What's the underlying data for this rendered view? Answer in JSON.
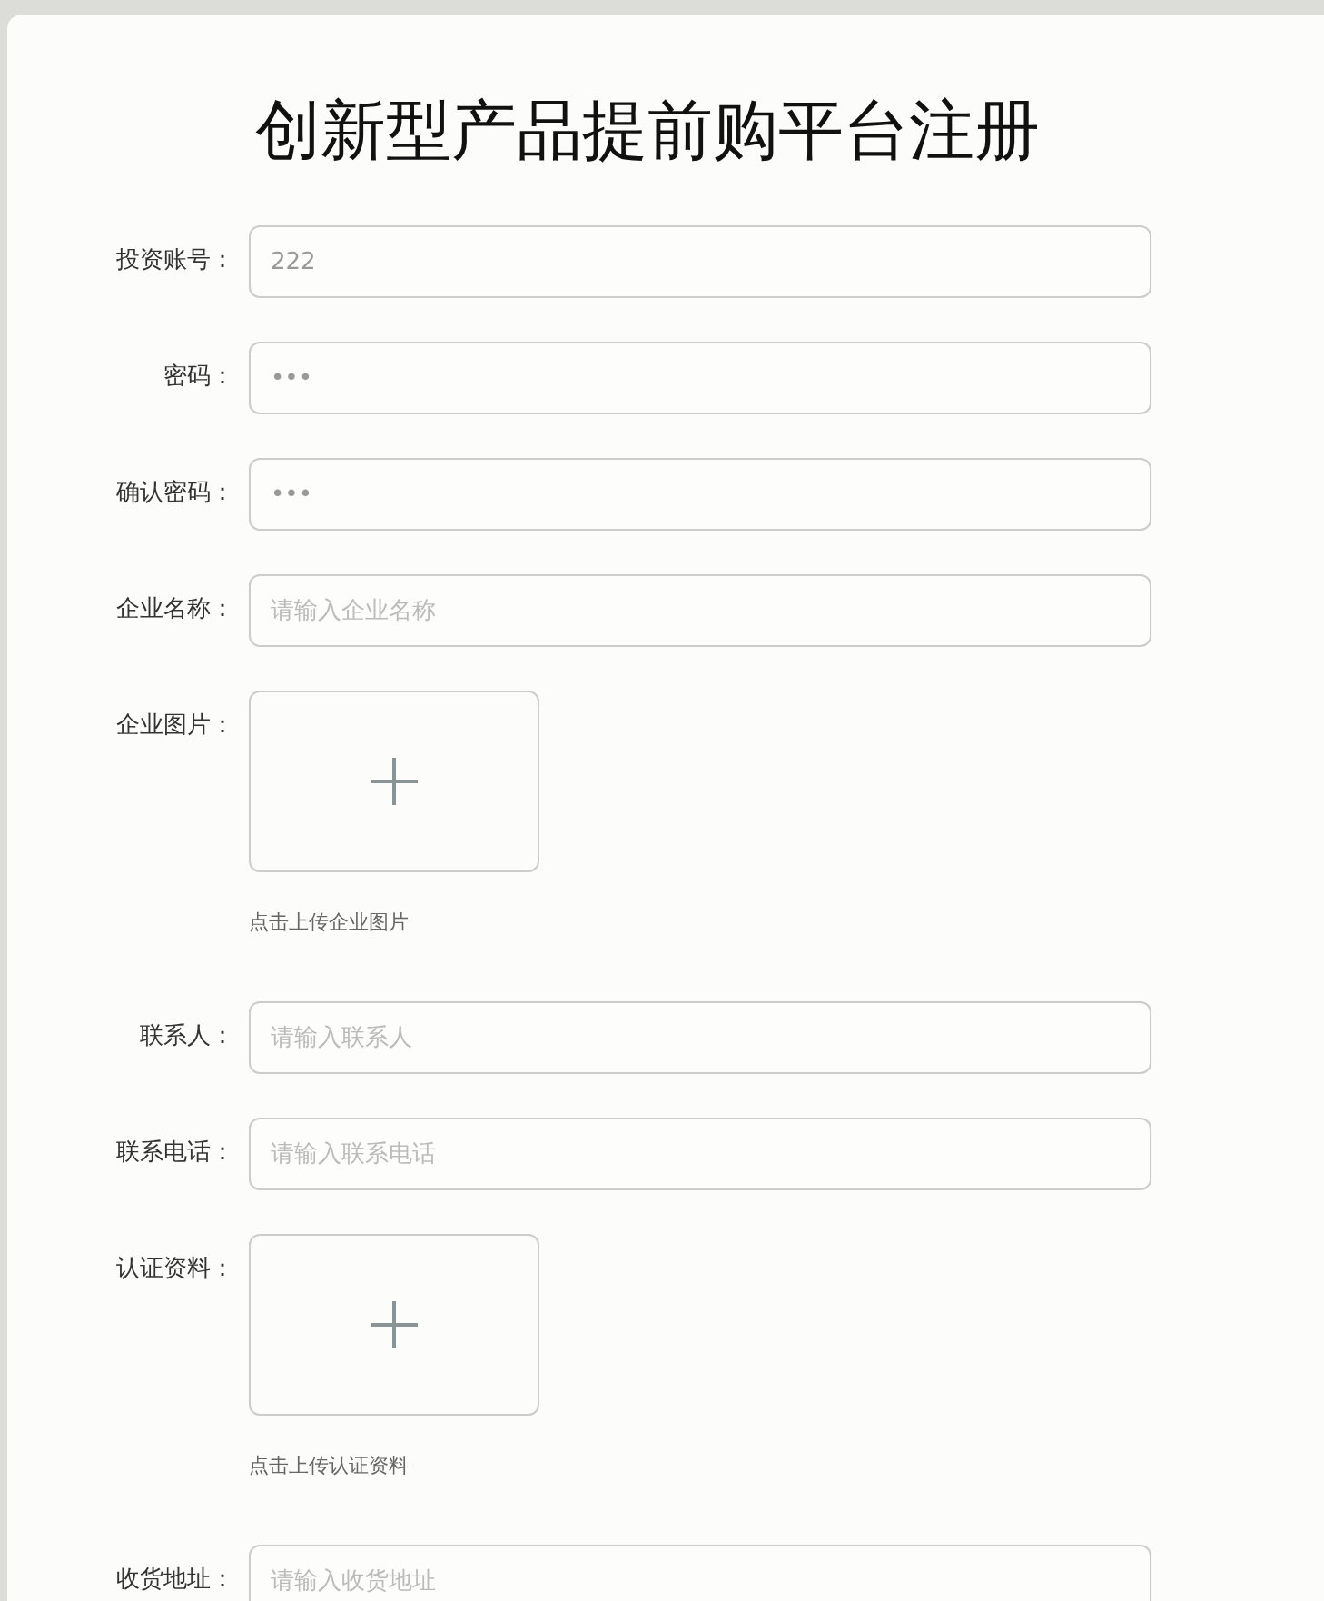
{
  "title": "创新型产品提前购平台注册",
  "fields": [
    {
      "kind": "text",
      "label": "投资账号：",
      "value": "222"
    },
    {
      "kind": "text",
      "label": "密码：",
      "value": "•••"
    },
    {
      "kind": "text",
      "label": "确认密码：",
      "value": "•••"
    },
    {
      "kind": "text",
      "label": "企业名称：",
      "placeholder": "请输入企业名称"
    },
    {
      "kind": "upload",
      "label": "企业图片：",
      "hint": "点击上传企业图片"
    },
    {
      "kind": "text",
      "label": "联系人：",
      "placeholder": "请输入联系人"
    },
    {
      "kind": "text",
      "label": "联系电话：",
      "placeholder": "请输入联系电话"
    },
    {
      "kind": "upload",
      "label": "认证资料：",
      "hint": "点击上传认证资料"
    },
    {
      "kind": "text",
      "label": "收货地址：",
      "placeholder": "请输入收货地址"
    }
  ]
}
